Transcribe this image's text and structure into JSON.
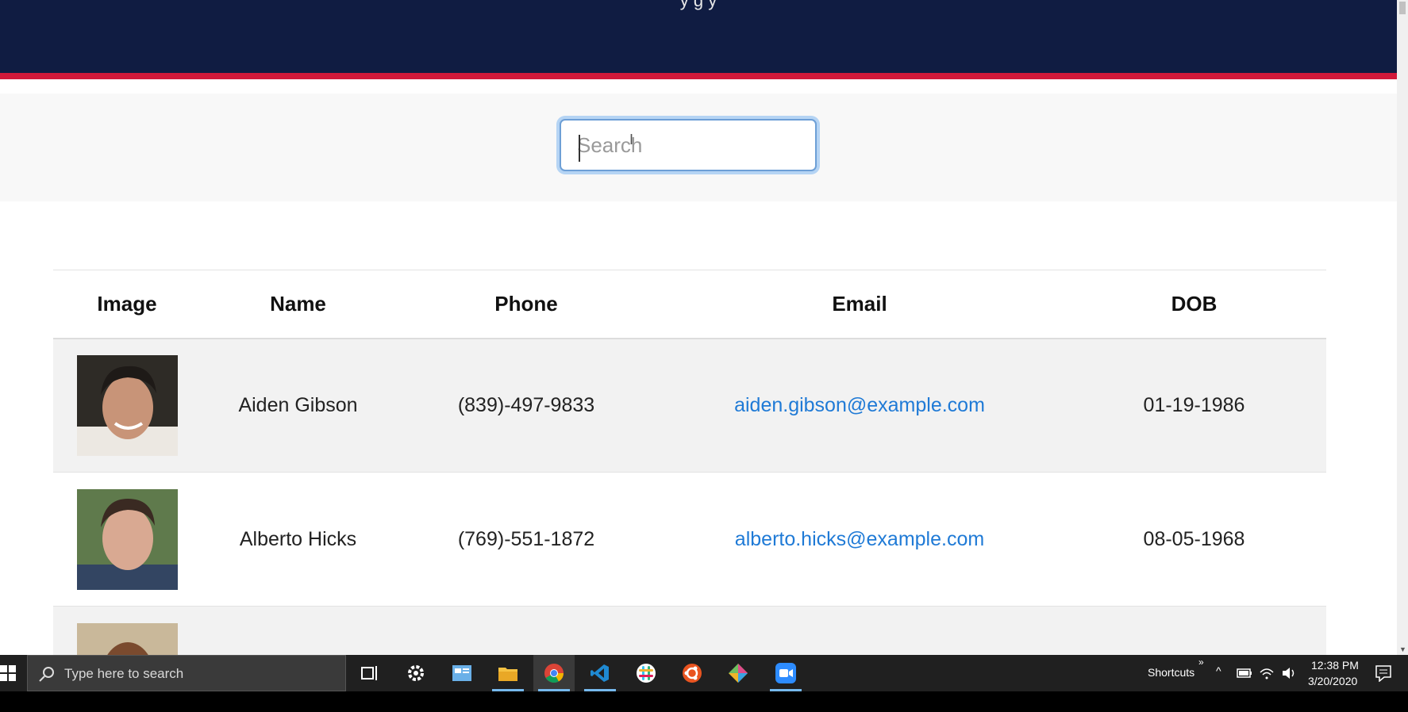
{
  "header": {
    "cut_text": "y      g                                             y"
  },
  "search": {
    "placeholder": "Search"
  },
  "table": {
    "columns": [
      "Image",
      "Name",
      "Phone",
      "Email",
      "DOB"
    ],
    "rows": [
      {
        "name": "Aiden Gibson",
        "phone": "(839)-497-9833",
        "email": "aiden.gibson@example.com",
        "dob": "01-19-1986"
      },
      {
        "name": "Alberto Hicks",
        "phone": "(769)-551-1872",
        "email": "alberto.hicks@example.com",
        "dob": "08-05-1968"
      }
    ]
  },
  "taskbar": {
    "search_placeholder": "Type here to search",
    "shortcuts_label": "Shortcuts",
    "time": "12:38 PM",
    "date": "3/20/2020",
    "apps": [
      "task-view",
      "settings",
      "control-panel",
      "file-explorer",
      "chrome",
      "vscode",
      "slack",
      "ubuntu",
      "git-kraken",
      "zoom"
    ]
  },
  "colors": {
    "header_bg": "#101c42",
    "header_accent": "#d1193a",
    "link": "#1f7ad6",
    "taskbar_bg": "#202020"
  }
}
